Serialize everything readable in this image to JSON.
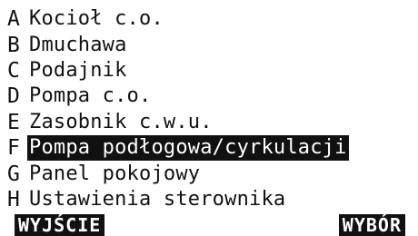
{
  "menu": {
    "items": [
      {
        "key": "A",
        "label": "Kocioł c.o."
      },
      {
        "key": "B",
        "label": "Dmuchawa"
      },
      {
        "key": "C",
        "label": "Podajnik"
      },
      {
        "key": "D",
        "label": "Pompa c.o."
      },
      {
        "key": "E",
        "label": "Zasobnik c.w.u."
      },
      {
        "key": "F",
        "label": "Pompa podłogowa/cyrkulacji"
      },
      {
        "key": "G",
        "label": "Panel pokojowy"
      },
      {
        "key": "H",
        "label": "Ustawienia sterownika"
      }
    ],
    "selected_key": "F"
  },
  "softkeys": {
    "left_label": "WYJŚCIE",
    "right_label": "WYBÓR"
  },
  "colors": {
    "background": "#ffffff",
    "foreground": "#111111",
    "highlight_background": "#111111",
    "highlight_text": "#ffffff"
  }
}
